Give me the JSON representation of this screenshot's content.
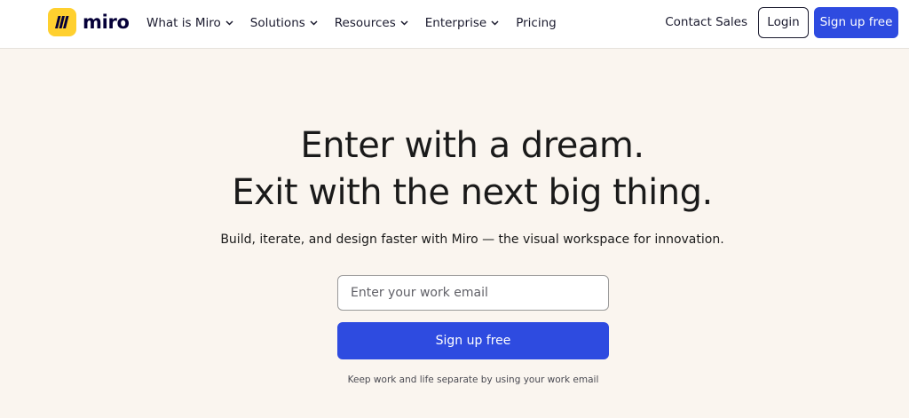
{
  "nav": {
    "logo_text": "miro",
    "menu": [
      {
        "label": "What is Miro",
        "has_dropdown": true
      },
      {
        "label": "Solutions",
        "has_dropdown": true
      },
      {
        "label": "Resources",
        "has_dropdown": true
      },
      {
        "label": "Enterprise",
        "has_dropdown": true
      },
      {
        "label": "Pricing",
        "has_dropdown": false
      }
    ],
    "contact_sales": "Contact Sales",
    "login": "Login",
    "signup": "Sign up free"
  },
  "hero": {
    "title_line1": "Enter with a dream.",
    "title_line2": "Exit with the next big thing.",
    "subtitle": "Build, iterate, and design faster with Miro — the visual workspace for innovation.",
    "email_placeholder": "Enter your work email",
    "signup_button": "Sign up free",
    "hint": "Keep work and life separate by using your work email"
  },
  "colors": {
    "brand_yellow": "#ffd02f",
    "accent_blue": "#2e4be0",
    "hero_background": "#faf5ef"
  },
  "icons": [
    "miro-logo-icon",
    "chevron-down-icon"
  ]
}
